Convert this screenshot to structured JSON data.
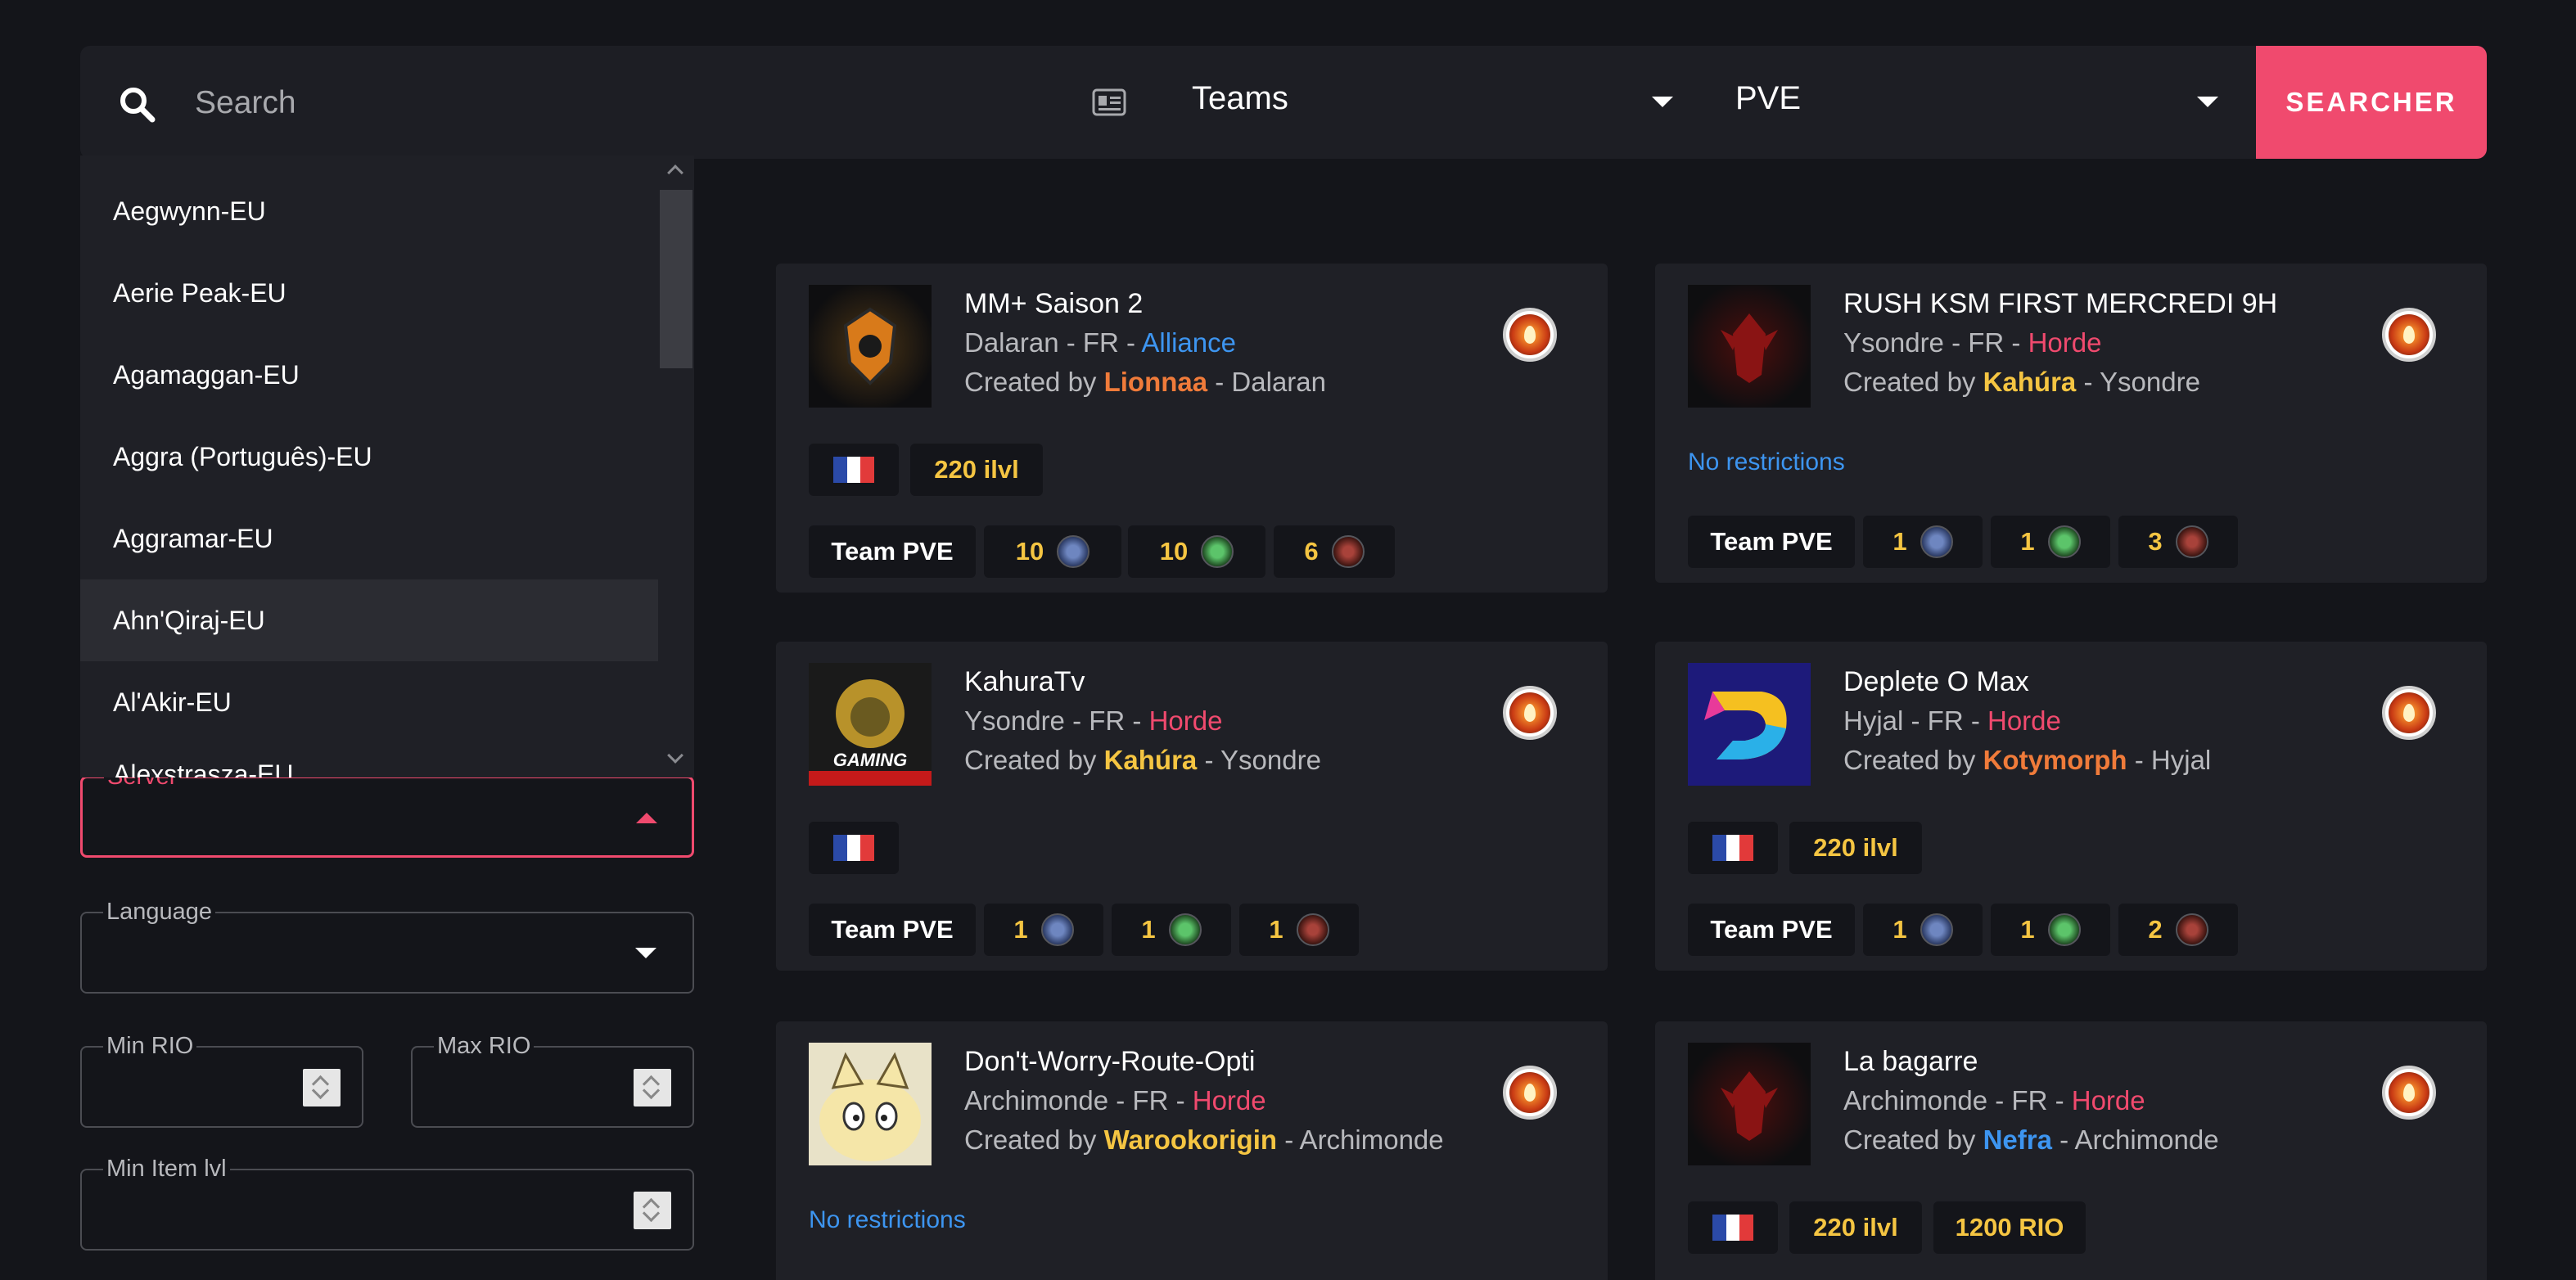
{
  "search": {
    "placeholder": "Search"
  },
  "selects": {
    "category": "Teams",
    "mode": "PVE"
  },
  "searcher_label": "SEARCHER",
  "filters": {
    "server_label": "Server",
    "language_label": "Language",
    "min_rio_label": "Min RIO",
    "max_rio_label": "Max RIO",
    "min_ilvl_label": "Min Item lvl"
  },
  "dropdown": {
    "items": [
      "Aegwynn-EU",
      "Aerie Peak-EU",
      "Agamaggan-EU",
      "Aggra (Português)-EU",
      "Aggramar-EU",
      "Ahn'Qiraj-EU",
      "Al'Akir-EU",
      "Alexstrasza-EU"
    ],
    "highlighted": "Ahn'Qiraj-EU"
  },
  "colors": {
    "accent": "#f04a6e",
    "alliance": "#3d95f0",
    "horde": "#f04a6e",
    "gold": "#f5c542"
  },
  "cards": [
    {
      "title": "MM+ Saison 2",
      "server": "Dalaran - FR - ",
      "faction": "Alliance",
      "created_prefix": "Created by ",
      "creator": "Lionnaa",
      "creator_server": " - Dalaran",
      "ilvl": "220 ilvl",
      "type": "Team PVE",
      "tanks": "10",
      "healers": "10",
      "dps": "6",
      "logo": "alliance-lion-logo",
      "status_icon": "fire-icon"
    },
    {
      "title": "RUSH KSM FIRST MERCREDI 9H",
      "server": "Ysondre - FR - ",
      "faction": "Horde",
      "created_prefix": "Created by ",
      "creator": "Kahúra",
      "creator_server": " - Ysondre",
      "restrictions": "No restrictions",
      "type": "Team PVE",
      "tanks": "1",
      "healers": "1",
      "dps": "3",
      "logo": "horde-emblem-logo",
      "status_icon": "fire-icon"
    },
    {
      "title": "KahuraTv",
      "server": "Ysondre - FR - ",
      "faction": "Horde",
      "created_prefix": "Created by ",
      "creator": "Kahúra",
      "creator_server": " - Ysondre",
      "type": "Team PVE",
      "tanks": "1",
      "healers": "1",
      "dps": "1",
      "logo": "gaming-lion-logo",
      "status_icon": "fire-icon"
    },
    {
      "title": "Deplete O Max",
      "server": "Hyjal - FR - ",
      "faction": "Horde",
      "created_prefix": "Created by ",
      "creator": "Kotymorph",
      "creator_server": " - Hyjal",
      "ilvl": "220 ilvl",
      "type": "Team PVE",
      "tanks": "1",
      "healers": "1",
      "dps": "2",
      "logo": "deplete-d-logo",
      "status_icon": "fire-icon"
    },
    {
      "title": "Don't-Worry-Route-Opti",
      "server": "Archimonde - FR - ",
      "faction": "Horde",
      "created_prefix": "Created by ",
      "creator": "Warookorigin",
      "creator_server": " - Archimonde",
      "restrictions": "No restrictions",
      "logo": "meowth-logo",
      "status_icon": "fire-icon"
    },
    {
      "title": "La bagarre",
      "server": "Archimonde - FR - ",
      "faction": "Horde",
      "created_prefix": "Created by ",
      "creator": "Nefra",
      "creator_server": " - Archimonde",
      "ilvl": "220 ilvl",
      "rio": "1200 RIO",
      "logo": "horde-emblem-logo",
      "status_icon": "fire-icon"
    }
  ]
}
